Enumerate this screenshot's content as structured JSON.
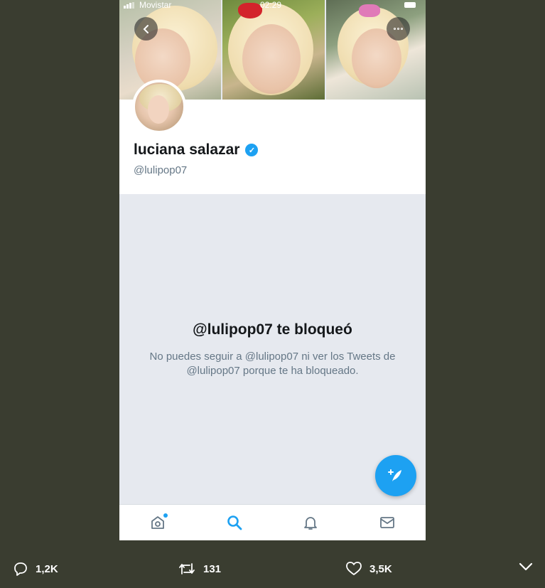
{
  "status_bar": {
    "carrier": "Movistar",
    "time": "02:29"
  },
  "profile": {
    "display_name": "luciana salazar",
    "handle": "@lulipop07",
    "verified": true
  },
  "blocked": {
    "title": "@lulipop07 te bloqueó",
    "body": "No puedes seguir a @lulipop07 ni ver los Tweets de @lulipop07 porque te ha bloqueado."
  },
  "tabs": [
    "home-icon",
    "search-icon",
    "notifications-icon",
    "messages-icon"
  ],
  "actions": {
    "replies": "1,2K",
    "retweets": "131",
    "likes": "3,5K"
  },
  "colors": {
    "accent": "#1da1f2",
    "outer_background": "#3a3d30",
    "blocked_area": "#e6e9ef"
  }
}
